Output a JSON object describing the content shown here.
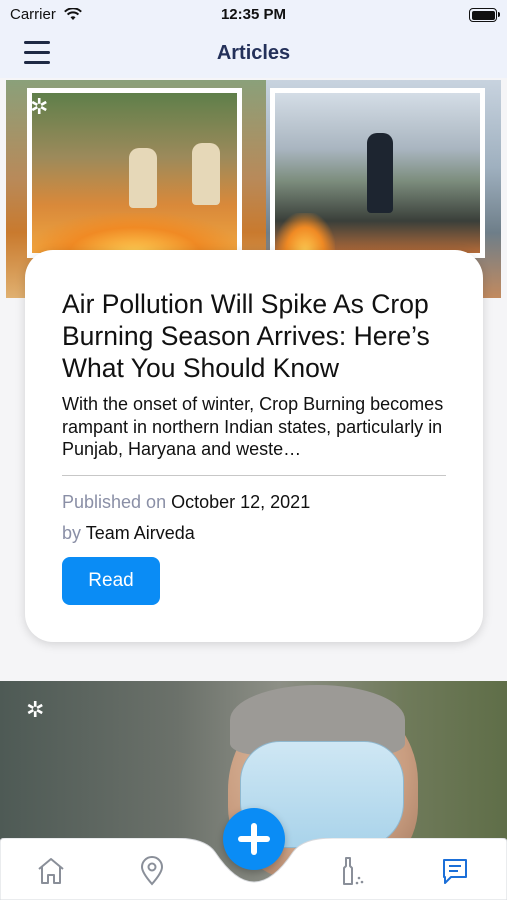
{
  "status_bar": {
    "carrier": "Carrier",
    "time": "12:35 PM"
  },
  "nav": {
    "title": "Articles"
  },
  "article": {
    "title": "Air Pollution Will Spike As Crop Burning Season Arrives: Here’s What You Should Know",
    "excerpt": "With the onset of winter, Crop Burning becomes rampant in northern Indian states, particularly in Punjab, Haryana and weste…",
    "published_label": "Published on",
    "published_date": "October 12, 2021",
    "by_label": "by",
    "author": "Team Airveda",
    "read_label": "Read"
  },
  "colors": {
    "accent": "#0a8cf5",
    "nav_title": "#24315a",
    "tab_active": "#1b6fd8",
    "tab_inactive": "#8a8f99"
  },
  "tabs": [
    {
      "icon": "home-icon",
      "active": false
    },
    {
      "icon": "location-pin-icon",
      "active": false
    },
    {
      "icon": "inhaler-icon",
      "active": false
    },
    {
      "icon": "chat-icon",
      "active": true
    }
  ]
}
